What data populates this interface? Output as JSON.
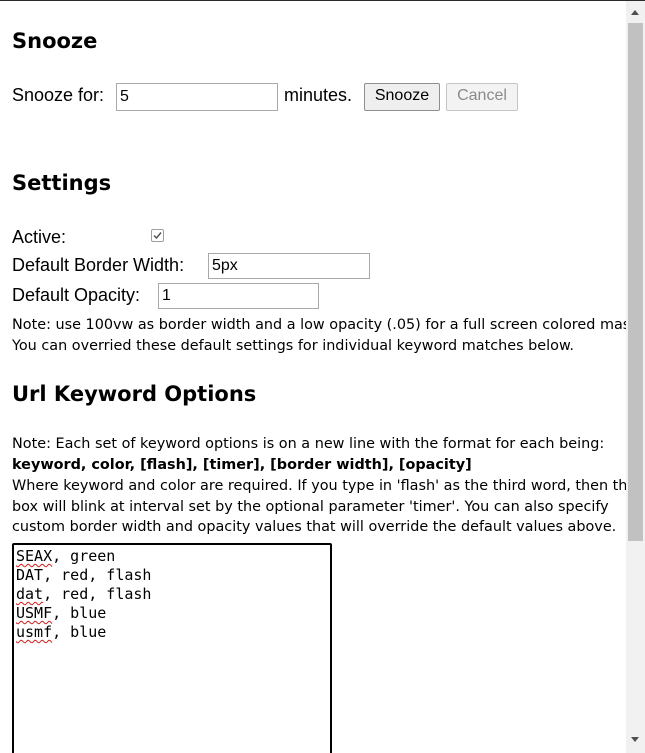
{
  "snooze": {
    "heading": "Snooze",
    "label": "Snooze for:",
    "value": "5",
    "unit": "minutes.",
    "snooze_button": "Snooze",
    "cancel_button": "Cancel"
  },
  "settings": {
    "heading": "Settings",
    "active_label": "Active:",
    "active_checked": true,
    "border_label": "Default Border Width:",
    "border_value": "5px",
    "opacity_label": "Default Opacity:",
    "opacity_value": "1",
    "note1": "Note: use 100vw as border width and a low opacity (.05) for a full screen colored mask",
    "note2": "You can overried these default settings for individual keyword matches below."
  },
  "url_keywords": {
    "heading": "Url Keyword Options",
    "note_line1": "Note: Each set of keyword options is on a new line with the format for each being:",
    "format": "keyword, color, [flash], [timer], [border width], [opacity]",
    "desc1": "Where keyword and color are required. If you type in 'flash' as the third word, then the",
    "desc2": "box will blink at interval set by the optional parameter 'timer'. You can also specify",
    "desc3": "custom border width and opacity values that will override the default values above.",
    "lines": [
      {
        "kw": "SEAX",
        "rest": ", green"
      },
      {
        "kw": "DAT",
        "rest": ", red, flash"
      },
      {
        "kw": "dat",
        "rest": ", red, flash"
      },
      {
        "kw": "USMF",
        "rest": ", blue"
      },
      {
        "kw": "usmf",
        "rest": ", blue"
      }
    ]
  },
  "colors": {
    "spellcheck_underline": "#d21b1b",
    "scrollbar_track": "#f1f1f1",
    "scrollbar_thumb": "#c1c1c1"
  }
}
